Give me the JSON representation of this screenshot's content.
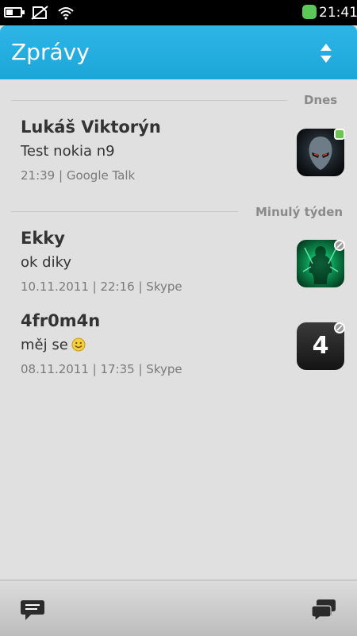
{
  "status_bar": {
    "time": "21:41",
    "icons": [
      "battery-icon",
      "no-sim-icon",
      "wifi-icon",
      "presence-online-icon"
    ],
    "colors": {
      "online": "#5cc85a"
    }
  },
  "header": {
    "title": "Zprávy",
    "sort_icon": "sort-arrows-icon",
    "background": "#1ca6d8"
  },
  "sections": [
    {
      "label": "Dnes"
    },
    {
      "label": "Minulý týden"
    }
  ],
  "conversations": [
    {
      "name": "Lukáš Viktorýn",
      "message": "Test nokia n9",
      "meta": "21:39 | Google Talk",
      "avatar": "alien-avatar",
      "presence": "online"
    },
    {
      "name": "Ekky",
      "message": "ok diky",
      "meta": "10.11.2011 | 22:16 | Skype",
      "avatar": "green-figure-avatar",
      "presence": "offline"
    },
    {
      "name": "4fr0m4n",
      "message": "měj se",
      "emoticon": "smiley-icon",
      "meta": "08.11.2011 | 17:35 | Skype",
      "avatar": "digit-avatar",
      "avatar_text": "4",
      "presence": "offline"
    }
  ],
  "toolbar": {
    "left_icon": "new-message-icon",
    "right_icon": "conversations-icon"
  }
}
